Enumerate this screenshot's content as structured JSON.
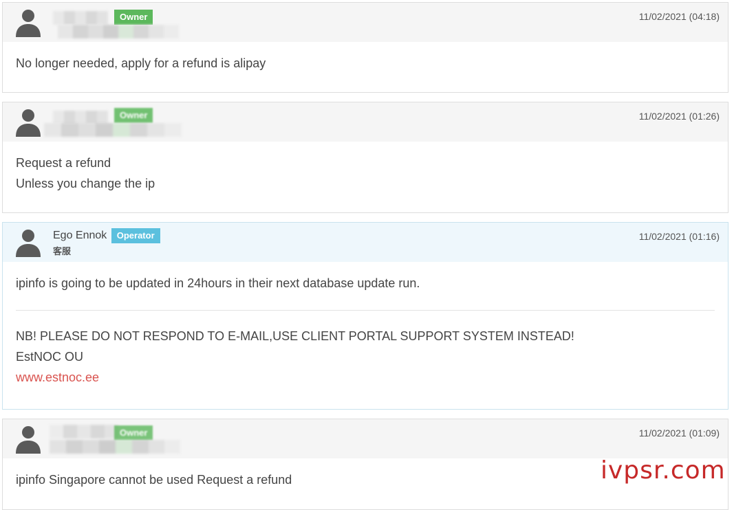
{
  "replies": [
    {
      "role": "owner",
      "badge": "Owner",
      "date": "11/02/2021 (04:18)",
      "lines": [
        "No longer needed, apply for a refund is alipay"
      ]
    },
    {
      "role": "owner",
      "badge": "Owner",
      "date": "11/02/2021 (01:26)",
      "lines": [
        "Request a refund",
        "Unless you change the ip"
      ]
    },
    {
      "role": "operator",
      "name": "Ego Ennok",
      "badge": "Operator",
      "subtitle": "客服",
      "date": "11/02/2021 (01:16)",
      "message": "ipinfo is going to be updated in 24hours in their next database update run.",
      "signature": {
        "notice": "NB! PLEASE DO NOT RESPOND TO E-MAIL,USE CLIENT PORTAL SUPPORT SYSTEM INSTEAD!",
        "company": "EstNOC OU",
        "link": "www.estnoc.ee"
      }
    },
    {
      "role": "owner",
      "badge": "Owner",
      "date": "11/02/2021 (01:09)",
      "lines": [
        "ipinfo Singapore cannot be used Request a refund"
      ]
    }
  ],
  "icons": {
    "avatar": "user-avatar-icon"
  },
  "colors": {
    "owner_badge": "#5cb85c",
    "operator_badge": "#5bc0de",
    "link": "#d9534f",
    "watermark": "#c62828"
  },
  "watermark": "ivpsr.com"
}
